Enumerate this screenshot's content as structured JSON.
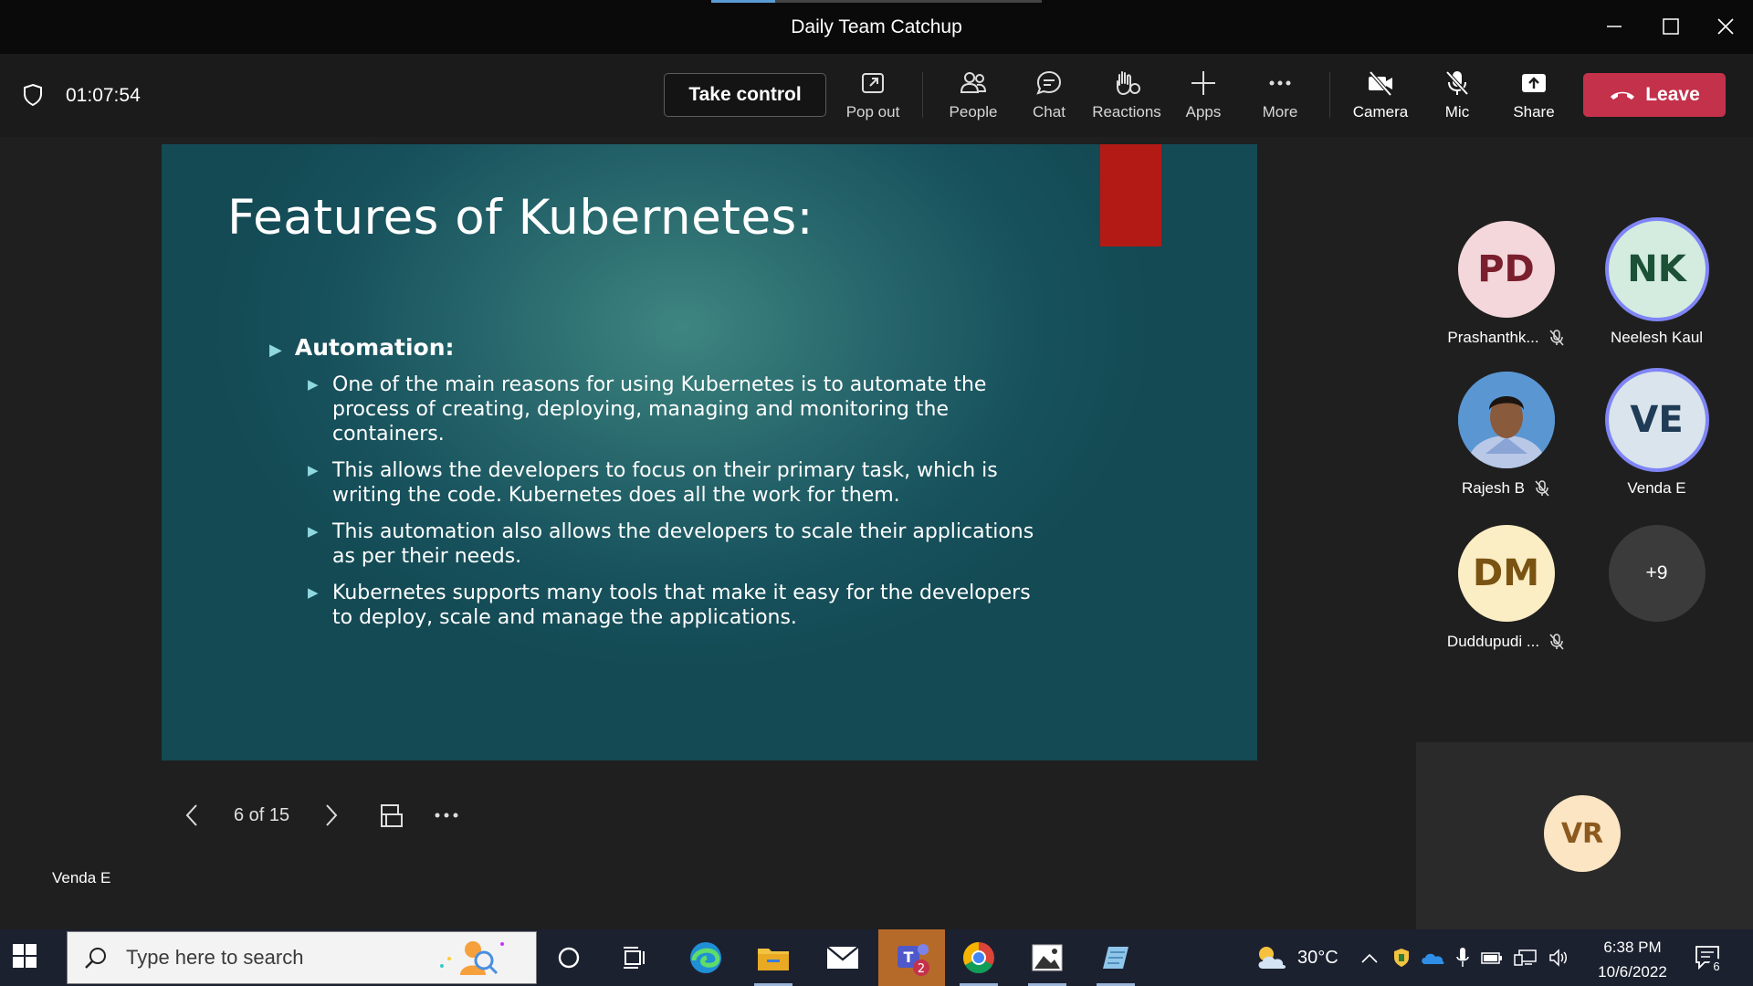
{
  "window": {
    "title": "Daily Team Catchup"
  },
  "toolbar": {
    "timer": "01:07:54",
    "take_control": "Take control",
    "pop_out": "Pop out",
    "people": "People",
    "chat": "Chat",
    "reactions": "Reactions",
    "apps": "Apps",
    "more": "More",
    "camera": "Camera",
    "mic": "Mic",
    "share": "Share",
    "leave": "Leave"
  },
  "slide": {
    "title": "Features of Kubernetes:",
    "main_bullet": "Automation:",
    "sub_bullets": [
      "One of the main reasons for using Kubernetes is to automate the process of creating, deploying, managing and monitoring the containers.",
      "This allows the developers to focus on their primary task, which is writing the code. Kubernetes does all the work for them.",
      "This automation also allows the developers to scale their applications as per their needs.",
      "Kubernetes supports many tools that make it easy for the developers to deploy, scale and manage the applications."
    ],
    "page_indicator": "6 of 15",
    "presenter": "Venda E"
  },
  "participants": [
    {
      "initials": "PD",
      "name": "Prashanthk...",
      "muted": true
    },
    {
      "initials": "NK",
      "name": "Neelesh Kaul",
      "muted": false
    },
    {
      "initials": "",
      "name": "Rajesh B",
      "muted": true
    },
    {
      "initials": "VE",
      "name": "Venda E",
      "muted": false
    },
    {
      "initials": "DM",
      "name": "Duddupudi ...",
      "muted": true
    }
  ],
  "overflow_count": "+9",
  "self_view": {
    "initials": "VR"
  },
  "colors": {
    "leave": "#c4314b",
    "speaking_ring": "#7f85f5",
    "slide_bg": "#25646a",
    "accent_bar": "#b31a16"
  },
  "taskbar": {
    "search_placeholder": "Type here to search",
    "weather": "30°C",
    "time": "6:38 PM",
    "date": "10/6/2022",
    "teams_badge": "2",
    "notifications": "6"
  }
}
